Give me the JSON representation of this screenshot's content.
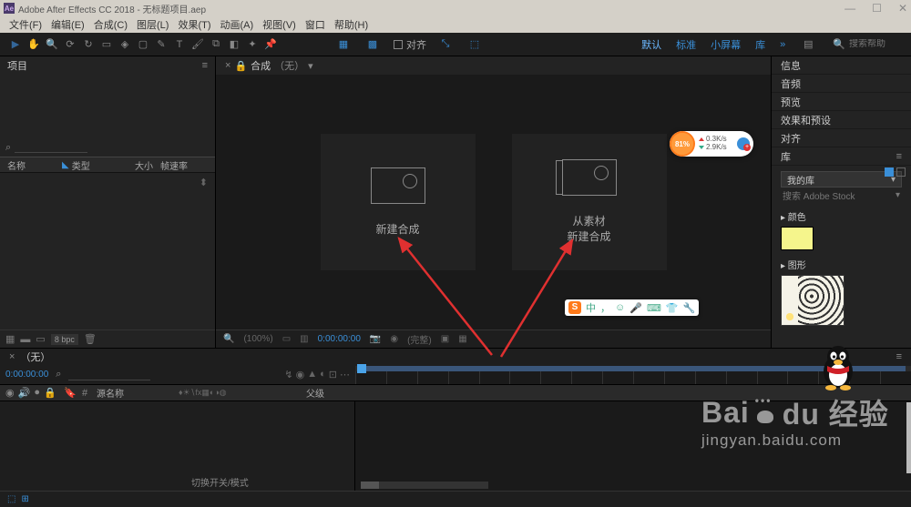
{
  "titlebar": {
    "app_icon": "Ae",
    "title": "Adobe After Effects CC 2018 - 无标题项目.aep"
  },
  "menu": {
    "file": "文件(F)",
    "edit": "编辑(E)",
    "composition": "合成(C)",
    "layer": "图层(L)",
    "effect": "效果(T)",
    "animation": "动画(A)",
    "view": "视图(V)",
    "window": "窗口",
    "help": "帮助(H)"
  },
  "tools": {
    "snapping": "对齐"
  },
  "workspaces": {
    "default": "默认",
    "standard": "标准",
    "small_screen": "小屏幕",
    "library": "库"
  },
  "search_help": {
    "placeholder": "搜索帮助"
  },
  "project": {
    "tab": "项目",
    "cols": {
      "name": "名称",
      "type": "类型",
      "size": "大小",
      "fps": "帧速率"
    },
    "bpc": "8 bpc"
  },
  "comp": {
    "tab_prefix": "合成",
    "tab_none": "（无）",
    "new_comp": "新建合成",
    "from_footage_l1": "从素材",
    "from_footage_l2": "新建合成",
    "zoom": "(100%)",
    "timecode": "0:00:00:00",
    "full": "(完整)"
  },
  "right": {
    "info": "信息",
    "audio": "音频",
    "preview": "预览",
    "effects": "效果和预设",
    "align": "对齐",
    "library": "库",
    "my_lib": "我的库",
    "stock_search": "搜索 Adobe Stock",
    "colors_hdr": "▸ 颜色",
    "graphics_hdr": "▸ 图形"
  },
  "timeline": {
    "tab": "（无）",
    "timecode": "0:00:00:00",
    "src_name": "源名称",
    "switches": "♦☀∖fx▦◐◑◍",
    "parent": "父级",
    "switch_label": "切换开关/模式"
  },
  "speed_widget": {
    "pct": "81%",
    "up": "0.3K/s",
    "down": "2.9K/s"
  },
  "ime": {
    "lang": "中",
    "punct": "，"
  },
  "watermark": {
    "brand": "Baidu 经验",
    "url": "jingyan.baidu.com"
  }
}
